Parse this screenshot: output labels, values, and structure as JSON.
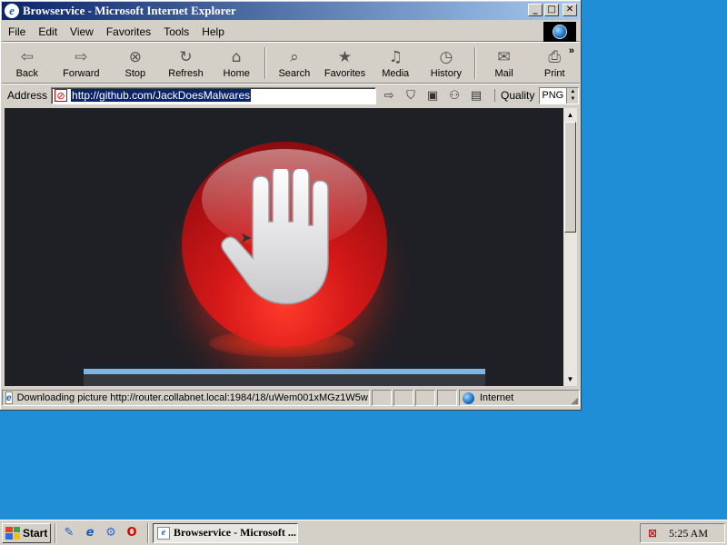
{
  "window": {
    "title": "Browservice - Microsoft Internet Explorer",
    "controls": {
      "minimize": "_",
      "maximize": "□",
      "close": "✕"
    }
  },
  "menu": {
    "items": [
      {
        "label": "File"
      },
      {
        "label": "Edit"
      },
      {
        "label": "View"
      },
      {
        "label": "Favorites"
      },
      {
        "label": "Tools"
      },
      {
        "label": "Help"
      }
    ]
  },
  "toolbar": {
    "buttons": [
      {
        "label": "Back",
        "icon": "back-arrow-icon",
        "glyph": "⇦"
      },
      {
        "label": "Forward",
        "icon": "forward-arrow-icon",
        "glyph": "⇨"
      },
      {
        "label": "Stop",
        "icon": "stop-icon",
        "glyph": "⊗"
      },
      {
        "label": "Refresh",
        "icon": "refresh-icon",
        "glyph": "↻"
      },
      {
        "label": "Home",
        "icon": "home-icon",
        "glyph": "⌂"
      },
      {
        "label": "Search",
        "icon": "search-icon",
        "glyph": "⌕"
      },
      {
        "label": "Favorites",
        "icon": "favorites-folder-icon",
        "glyph": "★"
      },
      {
        "label": "Media",
        "icon": "media-icon",
        "glyph": "♫"
      },
      {
        "label": "History",
        "icon": "history-icon",
        "glyph": "◷"
      },
      {
        "label": "Mail",
        "icon": "mail-icon",
        "glyph": "✉"
      },
      {
        "label": "Print",
        "icon": "printer-icon",
        "glyph": "⎙"
      }
    ],
    "more": "»"
  },
  "address": {
    "label": "Address",
    "url": "http://github.com/JackDoesMalwares",
    "quality_label": "Quality",
    "quality_value": "PNG"
  },
  "status": {
    "text": "Downloading picture http://router.collabnet.local:1984/18/uWem001xMGz1W5w",
    "zone": "Internet"
  },
  "taskbar": {
    "start_label": "Start",
    "task_label": "Browservice - Microsoft ...",
    "clock": "5:25 AM"
  },
  "colors": {
    "desktop": "#1f8ed6",
    "titlebar_start": "#0a246a",
    "titlebar_end": "#a6caf0",
    "page_background": "#1f2026",
    "stop_red": "#d41818"
  }
}
